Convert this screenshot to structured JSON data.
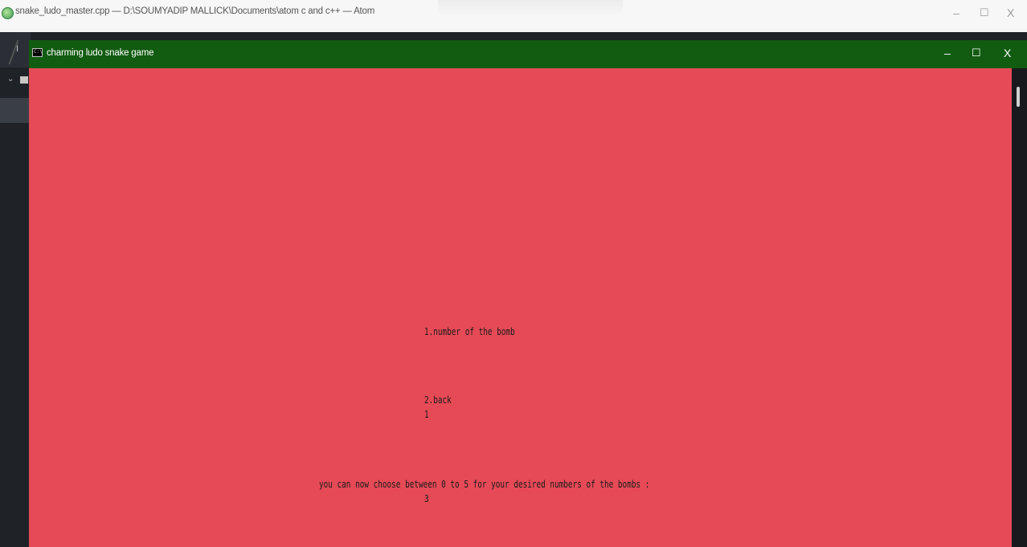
{
  "atom_window": {
    "title": "snake_ludo_master.cpp — D:\\SOUMYADIP MALLICK\\Documents\\atom c and c++ — Atom",
    "tab_label": "I",
    "controls": {
      "minimize": "–",
      "maximize": "☐",
      "close": "X"
    }
  },
  "console_window": {
    "icon_text": "C:\\",
    "title": "charming ludo snake game",
    "controls": {
      "minimize": "–",
      "maximize": "☐",
      "close": "X"
    },
    "background_color": "#e64a56",
    "titlebar_color": "#125c12"
  },
  "console_output": {
    "menu_item_1": "1.number of the bomb",
    "menu_item_2": "2.back",
    "user_choice": "1",
    "prompt": "you can now choose between 0 to 5 for your desired numbers of the bombs :",
    "user_input": "3"
  }
}
